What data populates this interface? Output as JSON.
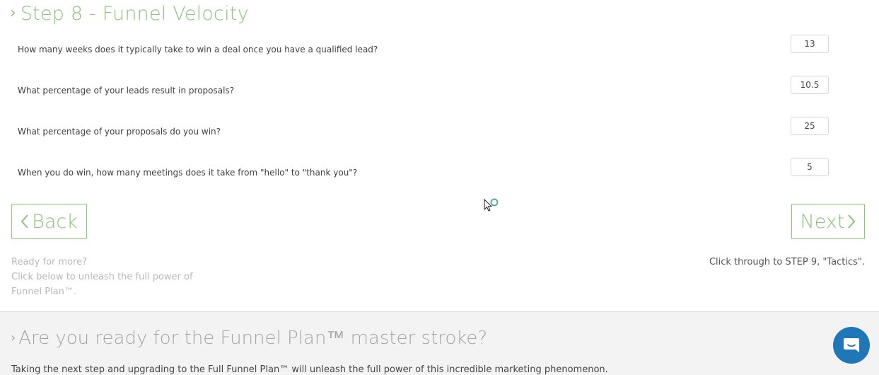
{
  "step": {
    "chevron": "›",
    "title": "Step 8 - Funnel Velocity"
  },
  "questions": [
    {
      "label": "How many weeks does it typically take to win a deal once you have a qualified lead?",
      "value": "13"
    },
    {
      "label": "What percentage of your leads result in proposals?",
      "value": "10.5"
    },
    {
      "label": "What percentage of your proposals do you win?",
      "value": "25"
    },
    {
      "label": "When you do win, how many meetings does it take from \"hello\" to \"thank you\"?",
      "value": "5"
    }
  ],
  "nav": {
    "back_label": "Back",
    "next_label": "Next",
    "back_icon": "chevron-left-icon",
    "next_icon": "chevron-right-icon"
  },
  "upsell": {
    "line1": "Ready for more?",
    "line2": "Click below to unleash the full power of",
    "line3": "Funnel Plan™."
  },
  "next_note": "Click through to STEP 9, \"Tactics\".",
  "master": {
    "chevron": "›",
    "title": "Are you ready for the Funnel Plan™ master stroke?",
    "desc": "Taking the next step and upgrading to the Full Funnel Plan™ will unleash the full power of this incredible marketing phenomenon."
  },
  "chat": {
    "icon": "chat-bubble-icon"
  },
  "colors": {
    "accent": "#8cc47a",
    "muted": "#b9b9b9",
    "chat": "#1f77b8"
  }
}
